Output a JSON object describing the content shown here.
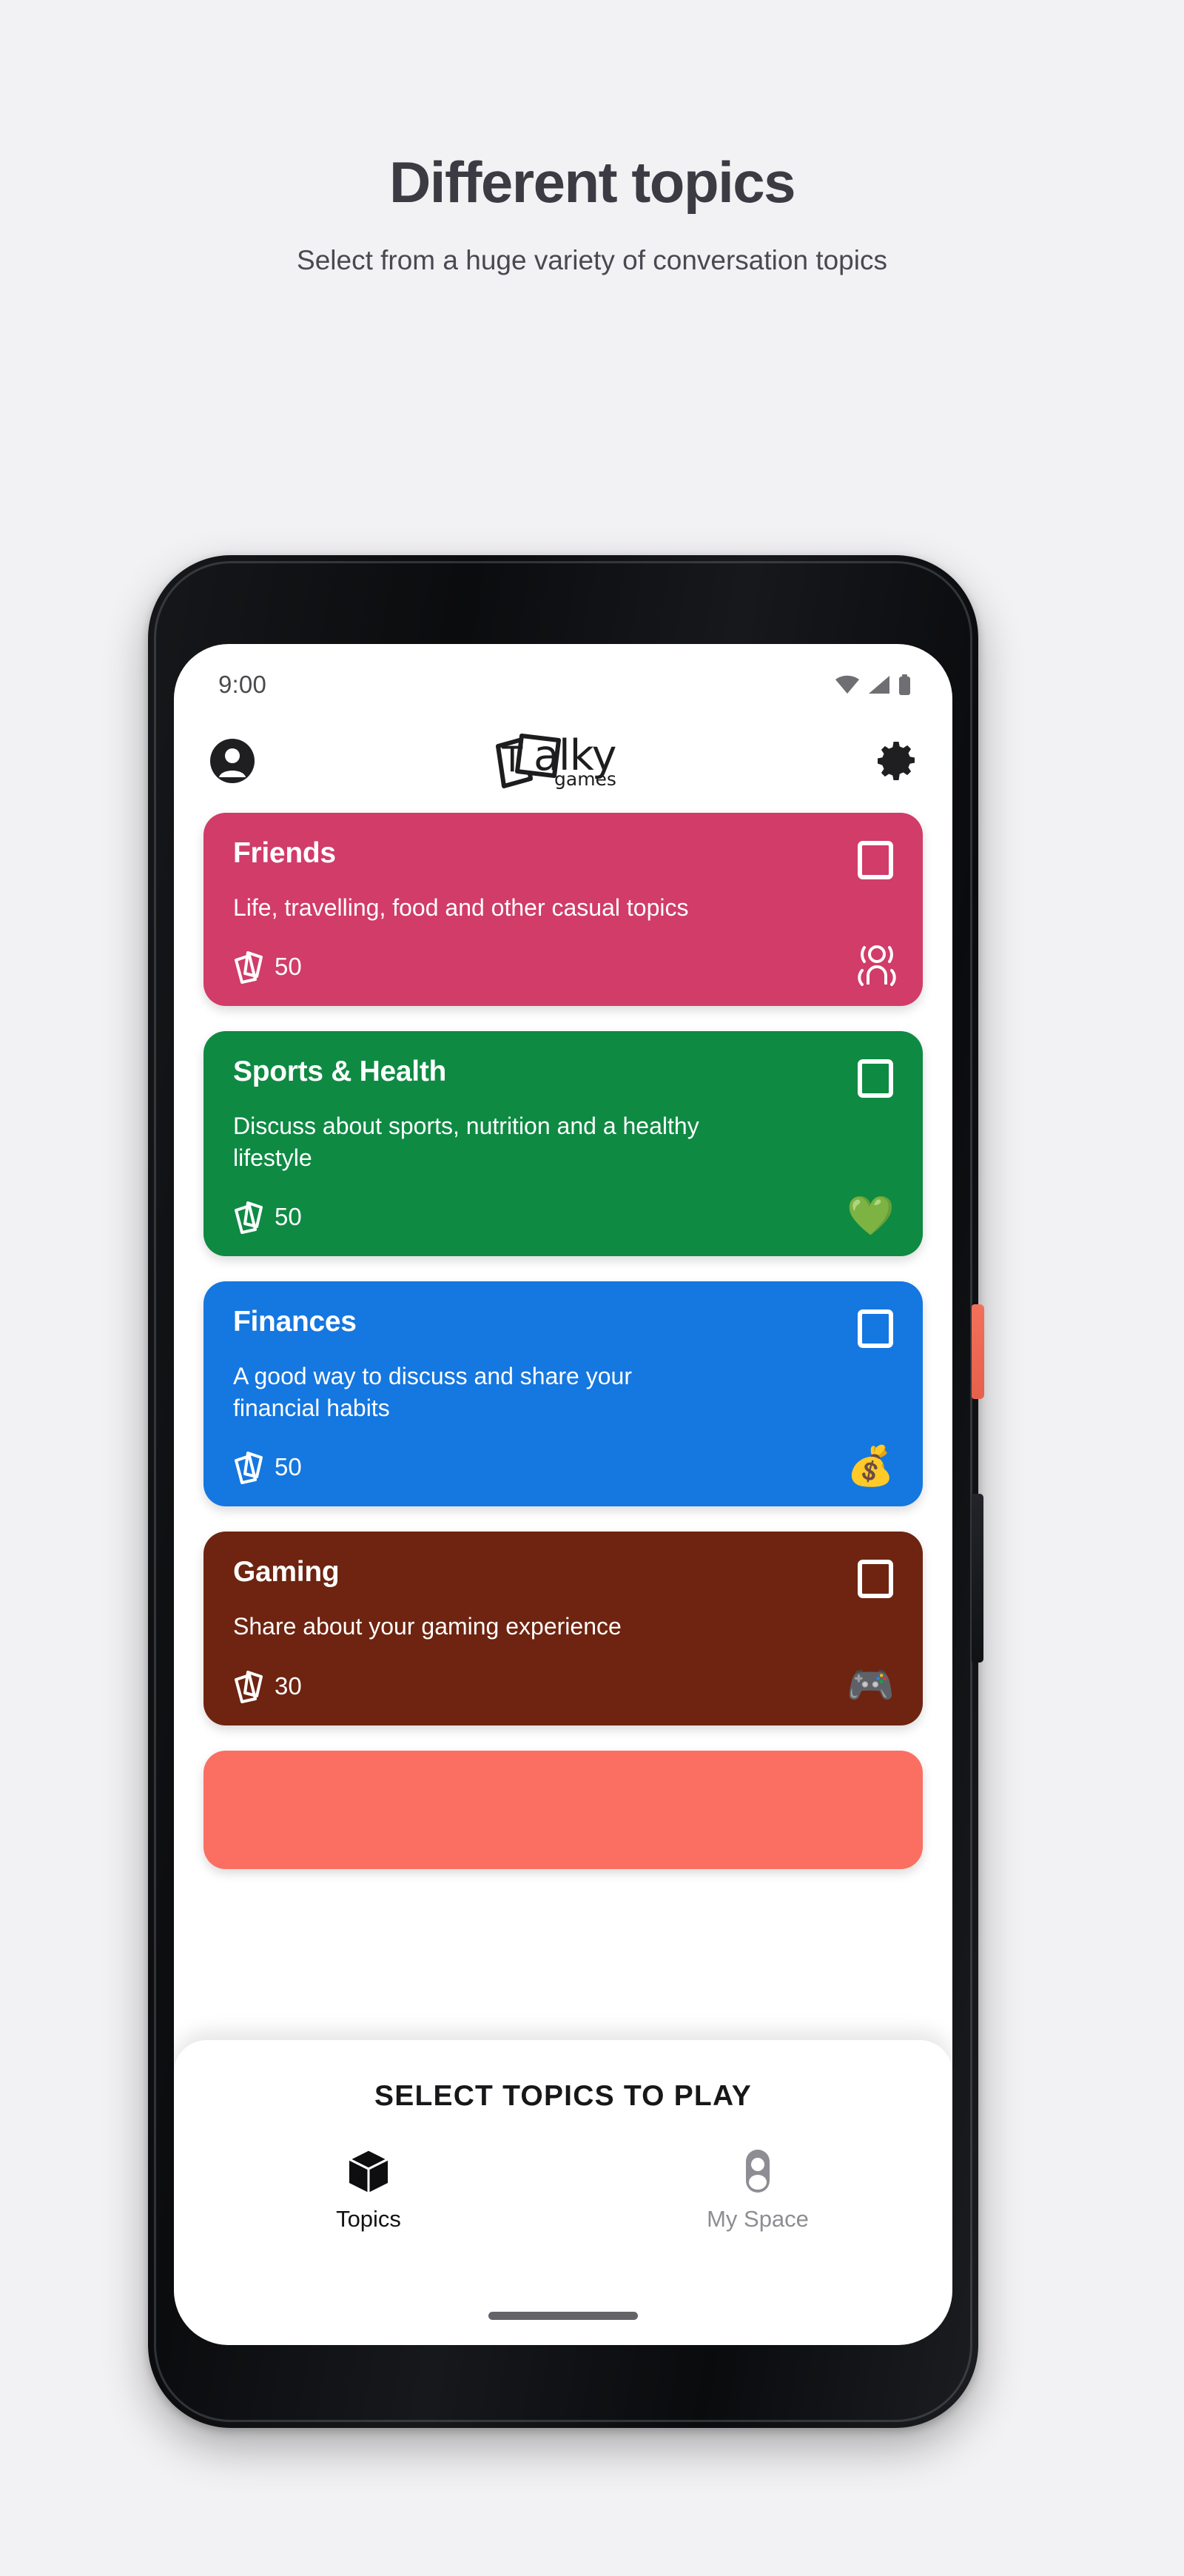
{
  "promo": {
    "title": "Different topics",
    "subtitle": "Select from a huge variety of conversation topics"
  },
  "phone": {
    "hardware": {
      "power_button": "power-button",
      "volume_button": "volume-rocker",
      "front_camera": "front-camera",
      "proximity_sensor": "proximity-sensor",
      "earpiece_speaker": "earpiece-speaker"
    }
  },
  "statusbar": {
    "time": "9:00",
    "icons": [
      "wifi-icon",
      "cellular-signal-icon",
      "battery-icon"
    ],
    "icon_color": "#6E6E73"
  },
  "appbar": {
    "account_icon": "account-circle-icon",
    "settings_icon": "gear-icon",
    "logo": {
      "mark": "card-deck-logo-icon",
      "letter": "T",
      "name": "alky",
      "tagline": "games"
    }
  },
  "topics": [
    {
      "title": "Friends",
      "description": "Life, travelling, food and other casual topics",
      "count": "50",
      "color": "#D13C69",
      "icon": "people-outline-icon",
      "emoji": "",
      "selected": false
    },
    {
      "title": "Sports & Health",
      "description": "Discuss about sports, nutrition and a healthy lifestyle",
      "count": "50",
      "color": "#0E8A43",
      "icon": "green-heart-pulse-emoji",
      "emoji": "💚",
      "selected": false
    },
    {
      "title": "Finances",
      "description": "A good way to discuss and share your financial habits",
      "count": "50",
      "color": "#1577E0",
      "icon": "money-bag-emoji",
      "emoji": "💰",
      "selected": false
    },
    {
      "title": "Gaming",
      "description": "Share about your gaming experience",
      "count": "30",
      "color": "#6E2410",
      "icon": "video-game-controller-emoji",
      "emoji": "🎮",
      "selected": false
    }
  ],
  "peek_card": {
    "color": "#FA6F61",
    "name": "next-topic-card-peek"
  },
  "bottom_sheet": {
    "title": "SELECT TOPICS TO PLAY",
    "nav": [
      {
        "label": "Topics",
        "icon": "cube-icon",
        "active": true
      },
      {
        "label": "My Space",
        "icon": "person-icon",
        "active": false
      }
    ]
  },
  "card_count_icon": "card-stack-icon",
  "checkbox_icon": "checkbox-unchecked-icon",
  "home_indicator": "home-indicator"
}
